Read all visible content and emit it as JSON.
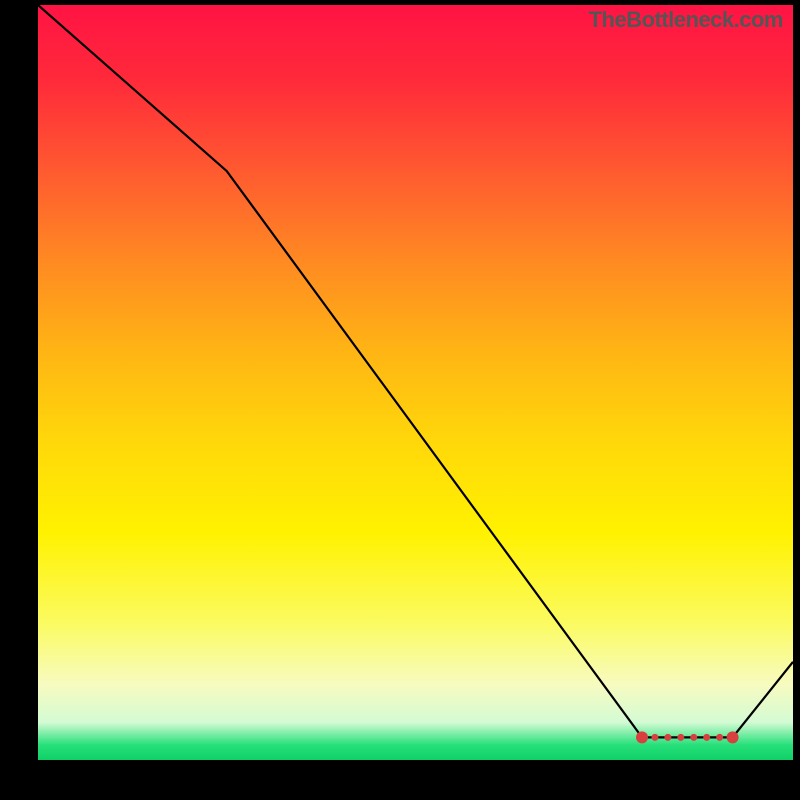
{
  "watermark": "TheBottleneck.com",
  "chart_data": {
    "type": "line",
    "title": "",
    "xlabel": "",
    "ylabel": "",
    "xlim": [
      0,
      100
    ],
    "ylim": [
      0,
      100
    ],
    "series": [
      {
        "name": "curve",
        "x": [
          0,
          25,
          80,
          92,
          100
        ],
        "values": [
          100,
          78,
          3,
          3,
          13
        ]
      }
    ],
    "markers": {
      "x_start": 80,
      "x_end": 92,
      "y": 3,
      "color": "#d84040",
      "count": 8
    },
    "annotations": []
  }
}
